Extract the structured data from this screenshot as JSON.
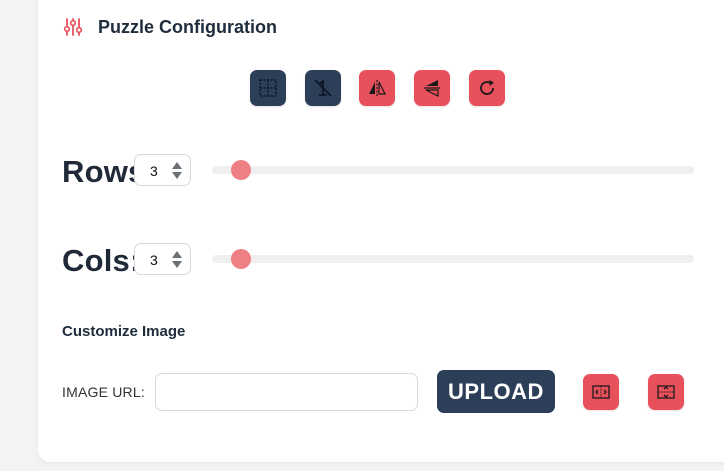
{
  "header": {
    "title": "Puzzle Configuration",
    "icon": "sliders-icon"
  },
  "toolbar": {
    "buttons": [
      {
        "name": "grid-toggle",
        "icon": "grid-dashed-icon",
        "color": "#2c3e58"
      },
      {
        "name": "numbers-off",
        "icon": "number-crossed-icon",
        "color": "#2c3e58"
      },
      {
        "name": "flip-horizontal",
        "icon": "flip-horizontal-icon",
        "color": "#e8505b"
      },
      {
        "name": "flip-vertical",
        "icon": "flip-vertical-icon",
        "color": "#e8505b"
      },
      {
        "name": "rotate",
        "icon": "rotate-icon",
        "color": "#e8505b"
      }
    ]
  },
  "rows": {
    "label": "Rows",
    "value": "3",
    "slider_fraction": 0.06
  },
  "cols": {
    "label": "Cols:",
    "value": "3",
    "slider_fraction": 0.06
  },
  "customize": {
    "title": "Customize Image",
    "url_label": "IMAGE URL:",
    "url_value": "",
    "upload_label": "UPLOAD",
    "fit_width_icon": "fit-width-icon",
    "fit_height_icon": "fit-height-icon"
  },
  "colors": {
    "accent_dark": "#2c3e58",
    "accent_red": "#e8505b",
    "slider_thumb": "#ee8085"
  }
}
